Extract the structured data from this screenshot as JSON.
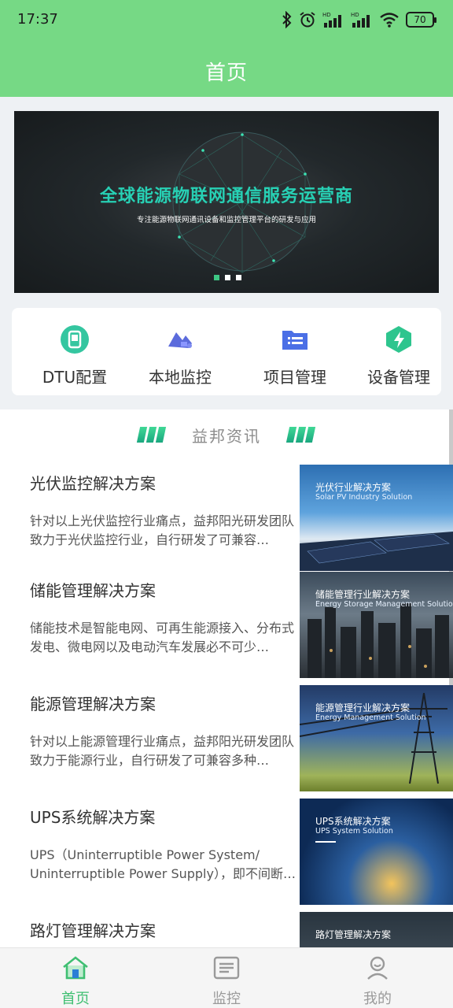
{
  "status_bar": {
    "time": "17:37",
    "battery": "70",
    "signal_labels": [
      "HD",
      "HD"
    ]
  },
  "header": {
    "title": "首页"
  },
  "banner": {
    "headline": "全球能源物联网通信服务运营商",
    "subtitle": "专注能源物联网通讯设备和监控管理平台的研发与应用",
    "slide_count": 3,
    "active_slide": 1
  },
  "quick_actions": [
    {
      "label": "DTU配置",
      "icon": "dtu-config-icon"
    },
    {
      "label": "本地监控",
      "icon": "local-monitor-icon"
    },
    {
      "label": "项目管理",
      "icon": "project-manage-icon"
    },
    {
      "label": "设备管理",
      "icon": "device-manage-icon"
    }
  ],
  "news": {
    "section_title": "益邦资讯",
    "articles": [
      {
        "title": "光伏监控解决方案",
        "summary": "针对以上光伏监控行业痛点，益邦阳光研发团队致力于光伏监控行业，自行研发了可兼容…",
        "thumb_title": "光伏行业解决方案",
        "thumb_subtitle": "Solar PV Industry Solution"
      },
      {
        "title": "储能管理解决方案",
        "summary": "储能技术是智能电网、可再生能源接入、分布式发电、微电网以及电动汽车发展必不可少…",
        "thumb_title": "储能管理行业解决方案",
        "thumb_subtitle": "Energy Storage Management Solution"
      },
      {
        "title": "能源管理解决方案",
        "summary": "针对以上能源管理行业痛点，益邦阳光研发团队致力于能源行业，自行研发了可兼容多种…",
        "thumb_title": "能源管理行业解决方案",
        "thumb_subtitle": "Energy Management Solution"
      },
      {
        "title": "UPS系统解决方案",
        "summary": "UPS（Uninterruptible Power System/ Uninterruptible Power Supply），即不间断…",
        "thumb_title": "UPS系统解决方案",
        "thumb_subtitle": "UPS System Solution"
      },
      {
        "title": "路灯管理解决方案",
        "summary": "",
        "thumb_title": "路灯管理解决方案",
        "thumb_subtitle": ""
      }
    ]
  },
  "bottom_nav": [
    {
      "label": "首页",
      "icon": "home-icon",
      "active": true
    },
    {
      "label": "监控",
      "icon": "monitor-list-icon",
      "active": false
    },
    {
      "label": "我的",
      "icon": "profile-icon",
      "active": false
    }
  ],
  "colors": {
    "primary": "#76d985",
    "accent": "#3fbf72",
    "banner_headline": "#27d0b4"
  }
}
